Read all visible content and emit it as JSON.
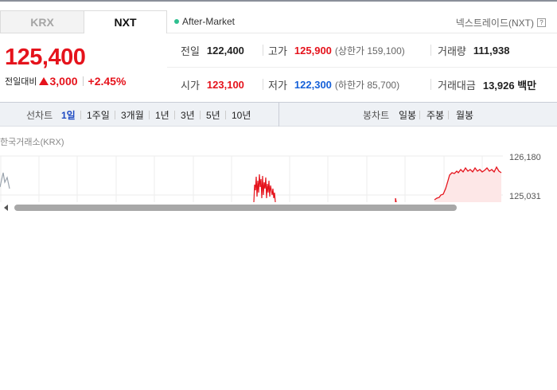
{
  "tabs": {
    "krx": "KRX",
    "nxt": "NXT"
  },
  "after_market": "After-Market",
  "nxt_link": {
    "label": "넥스트레이드(NXT)",
    "help_icon": "?"
  },
  "price": {
    "current": "125,400",
    "change_label": "전일대비",
    "change_value": "3,000",
    "change_rate": "+2.45%",
    "direction": "up"
  },
  "info": {
    "prev_close": {
      "label": "전일",
      "value": "122,400"
    },
    "high": {
      "label": "고가",
      "value": "125,900",
      "sub": "(상한가 159,100)"
    },
    "volume": {
      "label": "거래량",
      "value": "111,938"
    },
    "open": {
      "label": "시가",
      "value": "123,100"
    },
    "low": {
      "label": "저가",
      "value": "122,300",
      "sub": "(하한가 85,700)"
    },
    "amount": {
      "label": "거래대금",
      "value": "13,926 백만"
    }
  },
  "toolbar": {
    "line_chart": "선차트",
    "periods": [
      "1일",
      "1주일",
      "3개월",
      "1년",
      "3년",
      "5년",
      "10년"
    ],
    "active_period": "1일",
    "candle_chart": "봉차트",
    "candles": [
      "일봉",
      "주봉",
      "월봉"
    ]
  },
  "chart_title": "한국거래소(KRX)",
  "chart_data": {
    "type": "line",
    "y_ticks": [
      "126,180",
      "125,031"
    ],
    "y_tick_values": [
      126180,
      125031
    ],
    "color": "#e5131c",
    "fill": "#fde7e7"
  },
  "colors": {
    "up": "#e5131c",
    "down": "#1560d8",
    "accent": "#1d49c2"
  }
}
